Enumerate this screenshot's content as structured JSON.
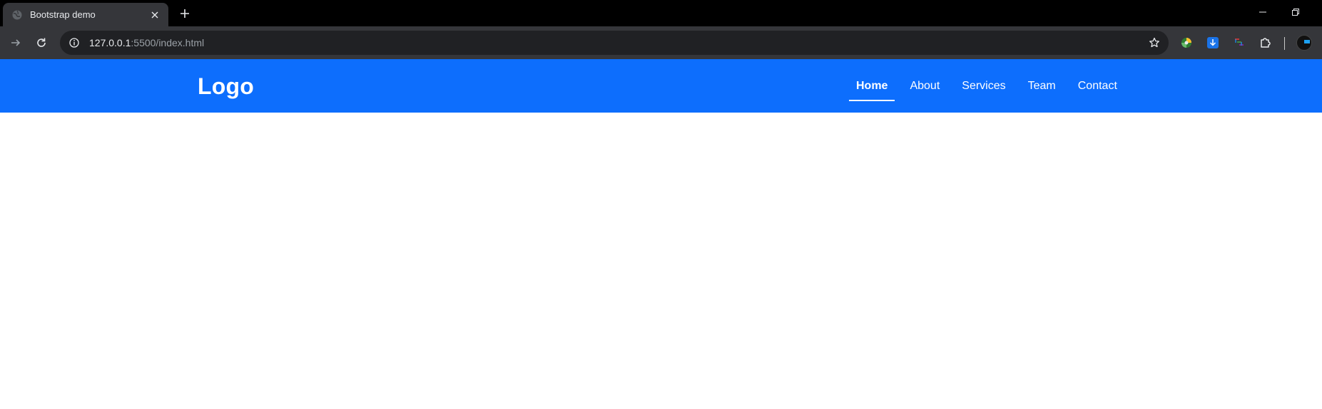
{
  "browser": {
    "tab": {
      "title": "Bootstrap demo"
    },
    "address": {
      "host": "127.0.0.1",
      "path": ":5500/index.html"
    },
    "icons": {
      "favicon": "globe-icon",
      "close": "close-icon",
      "new_tab": "plus-icon",
      "minimize": "minimize-icon",
      "restore": "restore-icon",
      "forward": "arrow-right-icon",
      "reload": "reload-icon",
      "site_info": "info-icon",
      "bookmark": "star-icon",
      "extensions": [
        "color-extension-icon",
        "download-extension-icon",
        "grid-extension-icon",
        "puzzle-icon"
      ],
      "profile": "profile-avatar"
    }
  },
  "navbar": {
    "logo": "Logo",
    "links": [
      {
        "label": "Home",
        "active": true
      },
      {
        "label": "About",
        "active": false
      },
      {
        "label": "Services",
        "active": false
      },
      {
        "label": "Team",
        "active": false
      },
      {
        "label": "Contact",
        "active": false
      }
    ],
    "background": "#0d6efd",
    "text_color": "#ffffff"
  }
}
